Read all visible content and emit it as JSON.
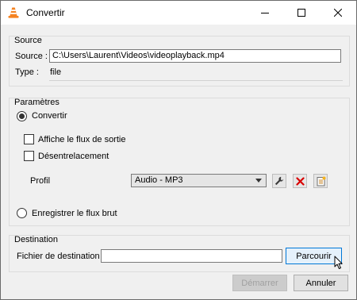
{
  "window": {
    "title": "Convertir"
  },
  "source": {
    "group_title": "Source",
    "source_label": "Source :",
    "source_value": "C:\\Users\\Laurent\\Videos\\videoplayback.mp4",
    "type_label": "Type :",
    "type_value": "file"
  },
  "parametres": {
    "group_title": "Paramètres",
    "convertir_label": "Convertir",
    "convertir_selected": true,
    "affiche_flux_label": "Affiche le flux de sortie",
    "affiche_flux_checked": false,
    "desentrelacement_label": "Désentrelacement",
    "desentrelacement_checked": false,
    "profil_label": "Profil",
    "profil_value": "Audio - MP3",
    "enregistrer_label": "Enregistrer le flux brut",
    "enregistrer_selected": false
  },
  "destination": {
    "group_title": "Destination",
    "fichier_label": "Fichier de destination :",
    "fichier_value": "",
    "parcourir_label": "Parcourir"
  },
  "footer": {
    "demarrer_label": "Démarrer",
    "annuler_label": "Annuler"
  },
  "icons": {
    "app": "vlc-cone-icon",
    "edit_profile": "wrench-icon",
    "delete_profile": "delete-x-icon",
    "new_profile": "new-profile-icon",
    "cursor": "mouse-pointer-icon"
  },
  "colors": {
    "accent": "#0078d7",
    "delete_red": "#d80000",
    "vlc_orange": "#f58220"
  }
}
